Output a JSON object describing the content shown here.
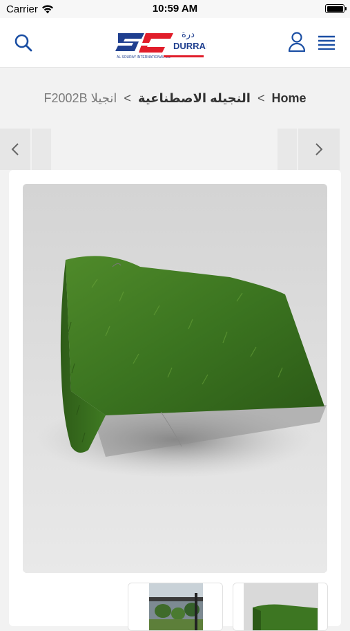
{
  "status_bar": {
    "carrier": "Carrier",
    "time": "10:59 AM",
    "battery_level": 1.0
  },
  "header": {
    "logo_text_en": "DURRAH",
    "logo_text_ar": "درة",
    "logo_subtext": "AL SOURAY INTERNATIONAL CO.",
    "colors": {
      "brand_blue": "#1f3f8f",
      "brand_red": "#e11d2a",
      "icon_blue": "#1a4ea3"
    }
  },
  "breadcrumb": {
    "home": "Home",
    "category": "النجيله الاصطناعية",
    "current": "F2002B انجيلا",
    "separator": ">"
  },
  "product": {
    "main_image_alt": "artificial grass sample",
    "thumbnails": [
      "outdoor-scene",
      "grass-sample"
    ]
  }
}
